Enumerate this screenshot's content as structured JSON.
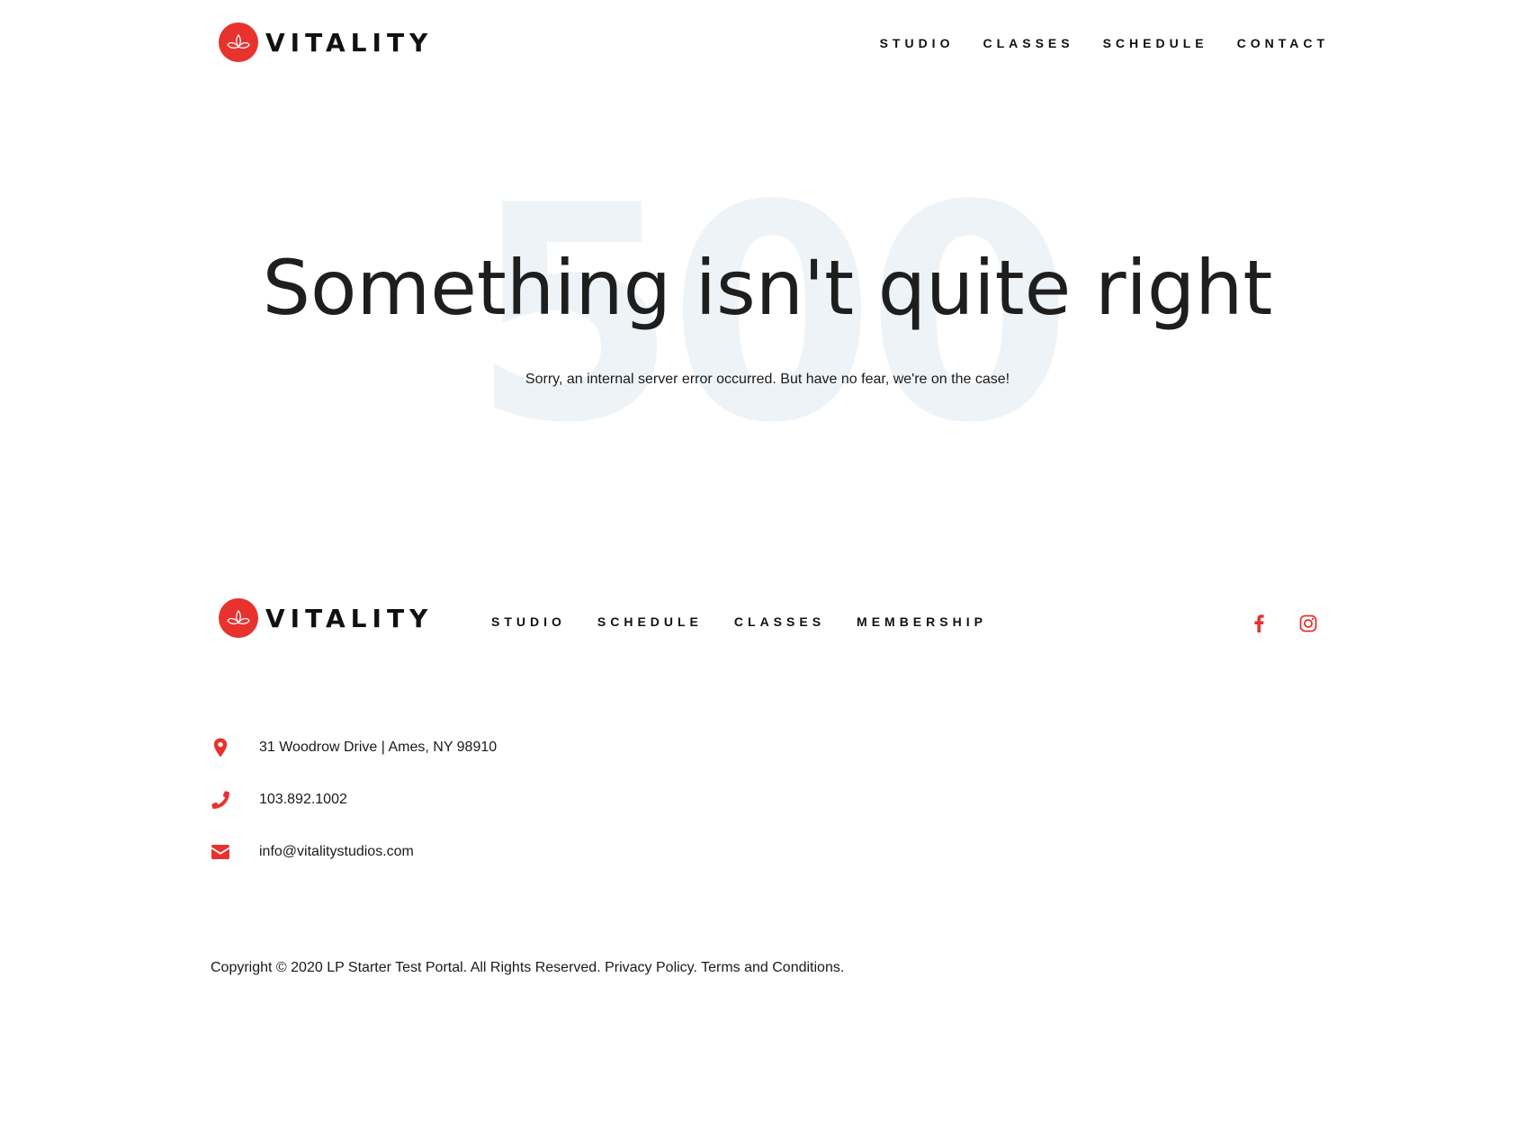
{
  "brand": {
    "name": "VITALITY",
    "accent_color": "#e8322e"
  },
  "header": {
    "nav": [
      {
        "label": "STUDIO"
      },
      {
        "label": "CLASSES"
      },
      {
        "label": "SCHEDULE"
      },
      {
        "label": "CONTACT"
      }
    ]
  },
  "hero": {
    "error_code": "500",
    "title": "Something isn't quite right",
    "subtitle": "Sorry, an internal server error occurred. But have no fear, we're on the case!"
  },
  "footer": {
    "nav": [
      {
        "label": "STUDIO"
      },
      {
        "label": "SCHEDULE"
      },
      {
        "label": "CLASSES"
      },
      {
        "label": "MEMBERSHIP"
      }
    ],
    "social": [
      {
        "icon": "facebook-icon"
      },
      {
        "icon": "instagram-icon"
      }
    ],
    "contact": {
      "address": "31 Woodrow Drive | Ames, NY 98910",
      "phone": "103.892.1002",
      "email": "info@vitalitystudios.com"
    },
    "copyright": {
      "text": "Copyright © 2020 LP Starter Test Portal. All Rights Reserved.",
      "privacy_label": "Privacy Policy.",
      "terms_label": "Terms and Conditions."
    }
  }
}
